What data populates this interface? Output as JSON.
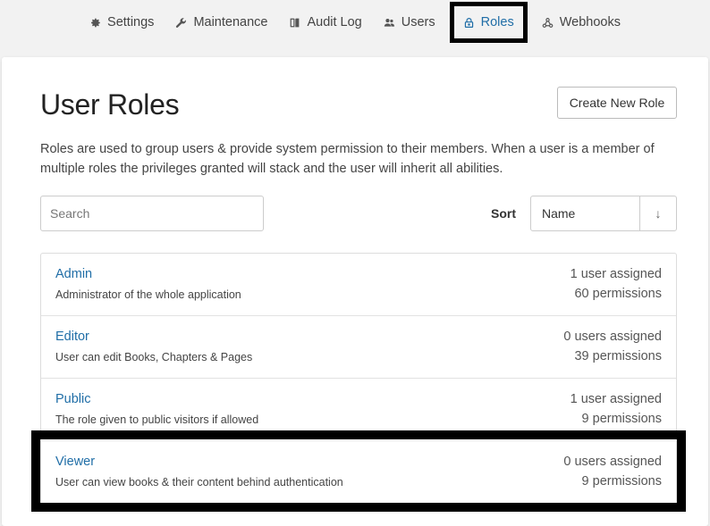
{
  "nav": {
    "items": [
      {
        "label": "Settings",
        "icon": "gear-icon"
      },
      {
        "label": "Maintenance",
        "icon": "wrench-icon"
      },
      {
        "label": "Audit Log",
        "icon": "book-icon"
      },
      {
        "label": "Users",
        "icon": "users-icon"
      },
      {
        "label": "Roles",
        "icon": "lock-icon",
        "active": true
      },
      {
        "label": "Webhooks",
        "icon": "webhook-icon"
      }
    ]
  },
  "page": {
    "title": "User Roles",
    "create_button": "Create New Role",
    "description": "Roles are used to group users & provide system permission to their members. When a user is a member of multiple roles the privileges granted will stack and the user will inherit all abilities."
  },
  "filters": {
    "search_placeholder": "Search",
    "sort_label": "Sort",
    "sort_value": "Name",
    "sort_direction": "↓"
  },
  "roles": [
    {
      "name": "Admin",
      "description": "Administrator of the whole application",
      "users": "1 user assigned",
      "permissions": "60 permissions"
    },
    {
      "name": "Editor",
      "description": "User can edit Books, Chapters & Pages",
      "users": "0 users assigned",
      "permissions": "39 permissions"
    },
    {
      "name": "Public",
      "description": "The role given to public visitors if allowed",
      "users": "1 user assigned",
      "permissions": "9 permissions"
    },
    {
      "name": "Viewer",
      "description": "User can view books & their content behind authentication",
      "users": "0 users assigned",
      "permissions": "9 permissions"
    }
  ],
  "colors": {
    "link": "#206ea7",
    "highlight": "#000000"
  }
}
